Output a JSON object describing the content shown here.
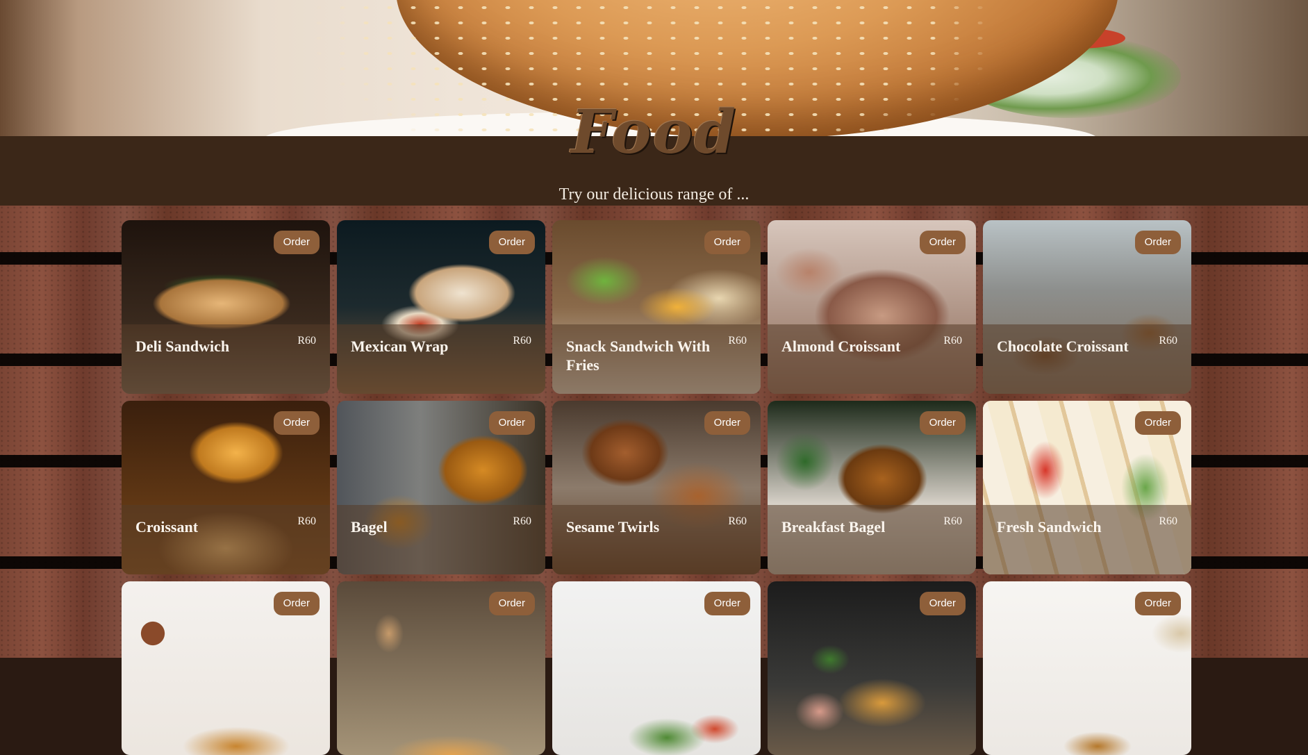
{
  "header": {
    "title": "Food",
    "subtitle": "Try our delicious range of ..."
  },
  "colors": {
    "band": "#3b2718",
    "order_button": "#8e5f3a",
    "caption_overlay": "rgba(85,60,40,0.55)",
    "text_light": "#fbf5ee"
  },
  "menu": {
    "items": [
      {
        "name": "Deli Sandwich",
        "price": "R60",
        "order_label": "Order"
      },
      {
        "name": "Mexican Wrap",
        "price": "R60",
        "order_label": "Order"
      },
      {
        "name": "Snack Sandwich With Fries",
        "price": "R60",
        "order_label": "Order"
      },
      {
        "name": "Almond Croissant",
        "price": "R60",
        "order_label": "Order"
      },
      {
        "name": "Chocolate Croissant",
        "price": "R60",
        "order_label": "Order"
      },
      {
        "name": "Croissant",
        "price": "R60",
        "order_label": "Order"
      },
      {
        "name": "Bagel",
        "price": "R60",
        "order_label": "Order"
      },
      {
        "name": "Sesame Twirls",
        "price": "R60",
        "order_label": "Order"
      },
      {
        "name": "Breakfast Bagel",
        "price": "R60",
        "order_label": "Order"
      },
      {
        "name": "Fresh Sandwich",
        "price": "R60",
        "order_label": "Order"
      },
      {
        "name": "",
        "price": "",
        "order_label": "Order"
      },
      {
        "name": "",
        "price": "",
        "order_label": "Order"
      },
      {
        "name": "",
        "price": "",
        "order_label": "Order"
      },
      {
        "name": "",
        "price": "",
        "order_label": "Order"
      },
      {
        "name": "",
        "price": "",
        "order_label": "Order"
      }
    ]
  }
}
